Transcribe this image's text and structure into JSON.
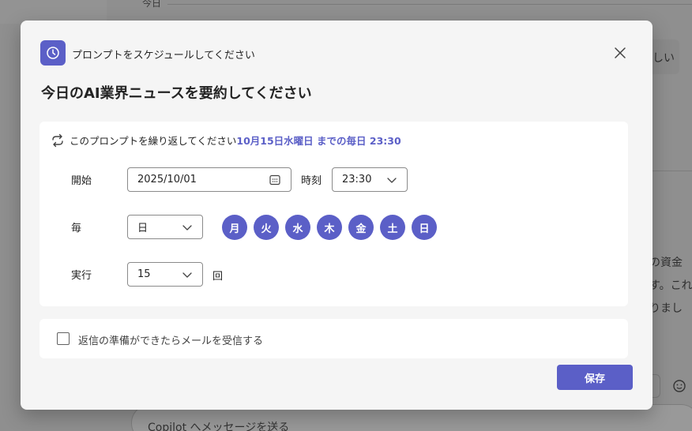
{
  "background": {
    "top_label": "今日",
    "right_snippets": [
      "しい",
      "の資金",
      "す。これ",
      "りまし"
    ],
    "input_placeholder": "Copilot へメッセージを送る"
  },
  "dialog": {
    "header_label": "プロンプトをスケジュールしてください",
    "title": "今日のAI業界ニュースを要約してください",
    "repeat_prefix": "このプロンプトを繰り返してください",
    "repeat_summary": "10月15日水曜日 までの毎日 23:30",
    "start_label": "開始",
    "start_date": "2025/10/01",
    "time_label": "時刻",
    "time_value": "23:30",
    "every_label": "毎",
    "every_value": "日",
    "days": [
      "月",
      "火",
      "水",
      "木",
      "金",
      "土",
      "日"
    ],
    "run_label": "実行",
    "run_count": "15",
    "run_unit": "回",
    "email_option": "返信の準備ができたらメールを受信する",
    "save_label": "保存"
  },
  "colors": {
    "accent": "#5b5fc7",
    "dialog_bg": "#f5f5f5",
    "overlay": "#8f8f8f"
  },
  "icons": {
    "header": "clock-icon",
    "repeat": "repeat-icon",
    "calendar": "calendar-icon",
    "chevron": "chevron-down-icon",
    "close": "close-icon"
  }
}
